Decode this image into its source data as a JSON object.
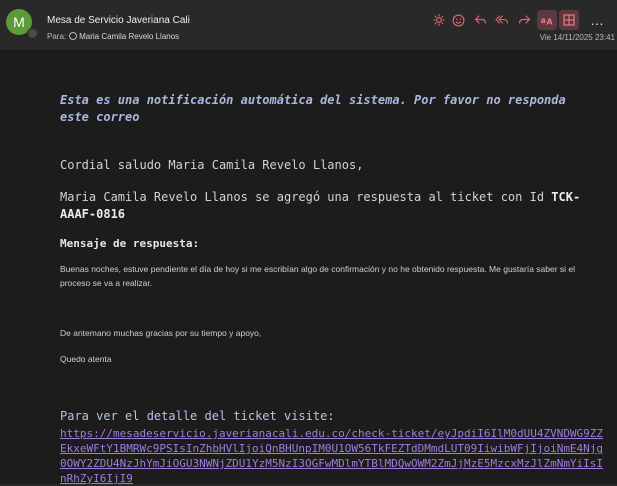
{
  "header": {
    "avatar_initial": "M",
    "sender": "Mesa de Servicio Javeriana Cali",
    "to_label": "Para:",
    "recipient": "Maria Camila Revelo Llanos",
    "date": "Vie 14/11/2025 23:41",
    "toolbar": {
      "icons": [
        "sun-icon",
        "smiley-icon",
        "reply-icon",
        "reply-all-icon",
        "forward-icon",
        "translate-icon",
        "grid-icon",
        "more-icon"
      ],
      "more_label": "…",
      "accent_color": "#e0626e"
    }
  },
  "body": {
    "notice": "Esta es una notificación automática del sistema. Por favor no responda este correo",
    "greeting": "Cordial saludo Maria Camila Revelo Llanos,",
    "added_text": "Maria Camila Revelo Llanos se agregó una respuesta al ticket con Id ",
    "ticket_id": "TCK-AAAF-0816",
    "response_heading": "Mensaje de respuesta:",
    "response_text": "Buenas noches, estuve pendiente el día de hoy si me escribían algo de confirmación y no he obtenido respuesta. Me gustaría saber si el proceso se va a realizar.",
    "thanks": "De antemano muchas gracias por su tiempo y apoyo,",
    "closing": "Quedo atenta",
    "detail_label": "Para ver el detalle del ticket visite:",
    "link": "https://mesadeservicio.javerianacali.edu.co/check-ticket/eyJpdiI6IlM0dUU4ZVNDWG9ZZEkxeWFtY1BMRWc9PSIsInZhbHVlIjoiQnBHUnpIM0U1OW56TkFEZTdDMmdLUT09IiwibWFjIjoiNmE4Njg0OWY2ZDU4NzJhYmJiOGU3NWNjZDU1YzM5NzI3OGFwMDlmYTBlMDQwOWM2ZmJjMzE5MzcxMzJlZmNmYiIsInRhZyI6IjI9"
  }
}
